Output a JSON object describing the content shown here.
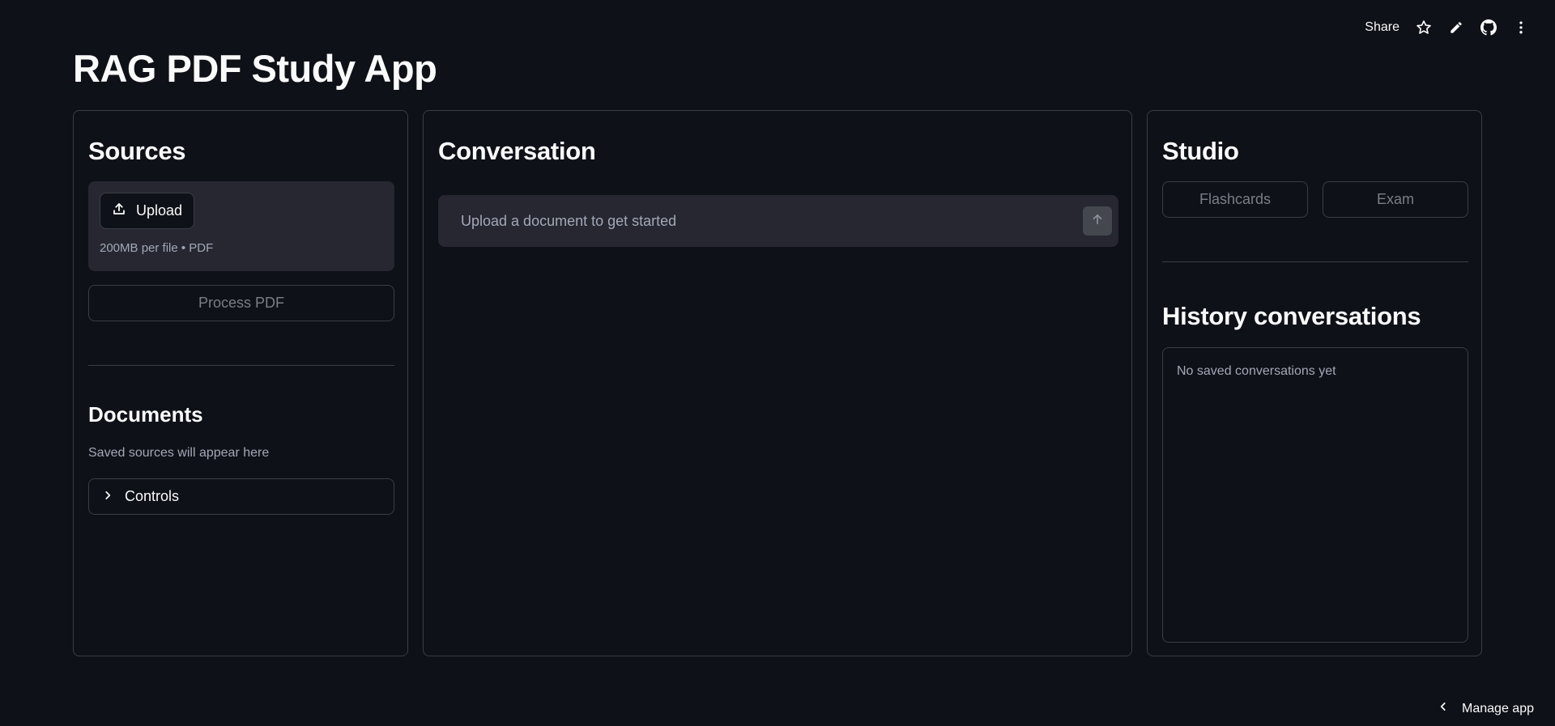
{
  "app": {
    "title": "RAG PDF Study App"
  },
  "toolbar": {
    "share_label": "Share",
    "icons": [
      "star-icon",
      "pencil-icon",
      "github-icon",
      "more-vertical-icon"
    ]
  },
  "sources": {
    "title": "Sources",
    "upload_label": "Upload",
    "upload_hint": "200MB per file • PDF",
    "process_label": "Process PDF"
  },
  "documents": {
    "title": "Documents",
    "empty_hint": "Saved sources will appear here",
    "controls_label": "Controls"
  },
  "conversation": {
    "title": "Conversation",
    "input_placeholder": "Upload a document to get started"
  },
  "studio": {
    "title": "Studio",
    "flashcards_label": "Flashcards",
    "exam_label": "Exam"
  },
  "history": {
    "title": "History conversations",
    "empty_text": "No saved conversations yet"
  },
  "footer": {
    "manage_label": "Manage app"
  },
  "colors": {
    "background": "#0e1117",
    "panel_border": "#3a3d46",
    "input_bg": "#262730",
    "text": "#fafafa",
    "muted_text": "#a3a8b8",
    "disabled_text": "#7a7e88"
  }
}
